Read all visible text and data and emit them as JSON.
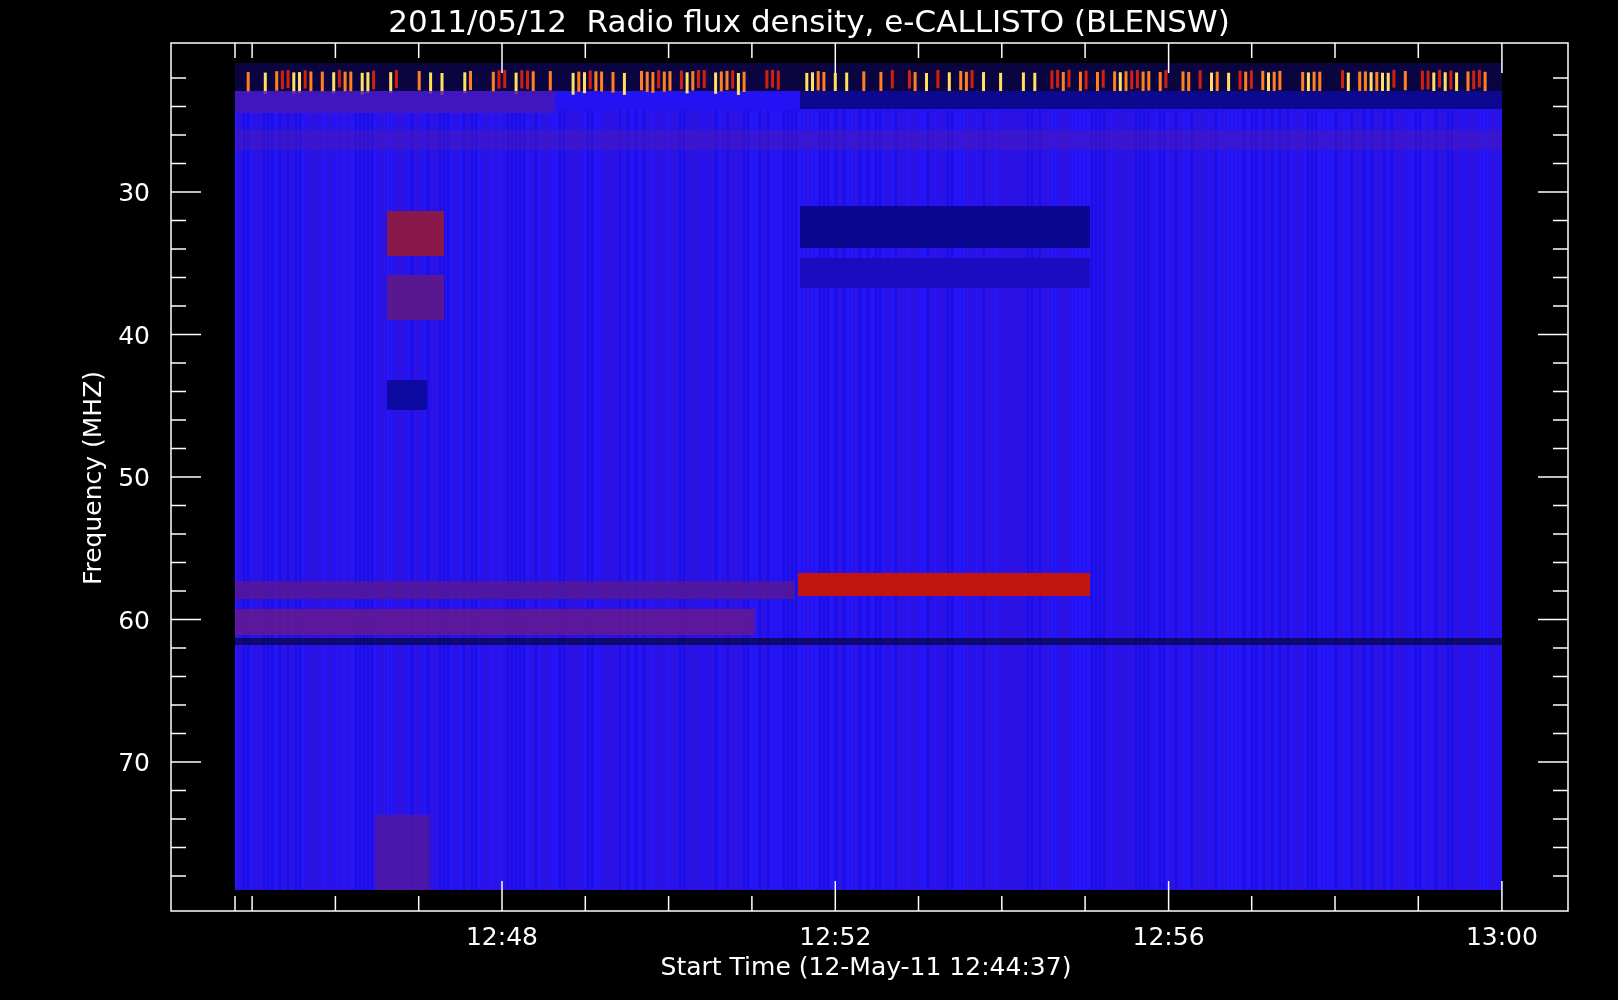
{
  "plot": {
    "title": "2011/05/12  Radio flux density, e-CALLISTO (BLENSW)",
    "xlabel": "Start Time (12-May-11 12:44:37)",
    "ylabel": "Frequency (MHZ)",
    "xticks": [
      "12:48",
      "12:52",
      "12:56",
      "13:00"
    ],
    "yticks": [
      "30",
      "40",
      "50",
      "60",
      "70"
    ]
  }
}
